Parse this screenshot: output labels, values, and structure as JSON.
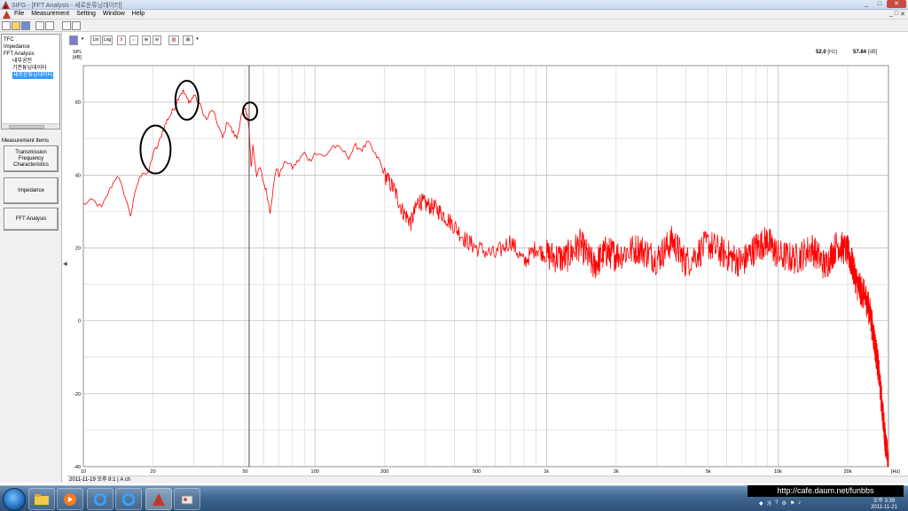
{
  "window": {
    "title": "SIFG - [FFT Analysis - 새로운튜닝데이터]",
    "controls": [
      "_",
      "□",
      "✕"
    ]
  },
  "menu": {
    "items": [
      "File",
      "Measurement",
      "Setting",
      "Window",
      "Help"
    ],
    "mdi_controls": [
      "_",
      "□",
      "✕"
    ]
  },
  "tree": {
    "items": [
      {
        "label": "TFC",
        "indent": 0
      },
      {
        "label": "Impedance",
        "indent": 0
      },
      {
        "label": "FFT Analysis",
        "indent": 0
      },
      {
        "label": "내부공진",
        "indent": 1
      },
      {
        "label": "기존튜닝데이터",
        "indent": 1
      },
      {
        "label": "새로운튜닝데이터",
        "indent": 1,
        "selected": true
      }
    ]
  },
  "measurement_items": {
    "header": "Measurement Items",
    "buttons": [
      "Transmission Frequency Characteristics",
      "Impedance",
      "FFT Analysis"
    ]
  },
  "chart_toolbar": {
    "lin_label": "Lin",
    "log_label": "Log"
  },
  "readout": {
    "freq_value": "52.0",
    "freq_unit": "[Hz]",
    "spl_value": "57.84",
    "spl_unit": "[dB]"
  },
  "status": {
    "text": "2011-11-19 오후 8:1 | A ch"
  },
  "taskbar": {
    "clock_time": "오후 3:39",
    "clock_date": "2011-11-21",
    "ime": "가"
  },
  "watermark": "http://cafe.daum.net/funbbs",
  "chart_data": {
    "type": "line",
    "ylabel": "SPL [dB]",
    "xunit": "[Hz]",
    "x_scale": "log",
    "xlim": [
      10,
      30000
    ],
    "ylim": [
      -40,
      70
    ],
    "yticks": [
      -40,
      -20,
      0,
      20,
      40,
      60
    ],
    "xtick_labels": [
      {
        "value": 10,
        "label": "10"
      },
      {
        "value": 20,
        "label": "20"
      },
      {
        "value": 50,
        "label": "50"
      },
      {
        "value": 100,
        "label": "100"
      },
      {
        "value": 200,
        "label": "200"
      },
      {
        "value": 500,
        "label": "500"
      },
      {
        "value": 1000,
        "label": "1k"
      },
      {
        "value": 2000,
        "label": "2k"
      },
      {
        "value": 5000,
        "label": "5k"
      },
      {
        "value": 10000,
        "label": "10k"
      },
      {
        "value": 20000,
        "label": "20k"
      }
    ],
    "grid": true,
    "cursor_x": 52,
    "line_color": "#ff0000",
    "series": [
      {
        "x": [
          10,
          11,
          12,
          13,
          14,
          15,
          16,
          17,
          18,
          19,
          20,
          21,
          22,
          23,
          24,
          25,
          26,
          27,
          28,
          29,
          30,
          32,
          34,
          36,
          38,
          40,
          42,
          44,
          46,
          48,
          50,
          51,
          52,
          53,
          54,
          55,
          56,
          58,
          60,
          62,
          64,
          66,
          68,
          70,
          75,
          80,
          85,
          90,
          95,
          100,
          110,
          120,
          130,
          140,
          150,
          160,
          170,
          180,
          190,
          200,
          220,
          240,
          260,
          280,
          300,
          330,
          360,
          400,
          450,
          500,
          600,
          700,
          800,
          900,
          1000,
          1200,
          1400,
          1600,
          1800,
          2000,
          2500,
          3000,
          3500,
          4000,
          5000,
          6000,
          7000,
          8000,
          9000,
          10000,
          12000,
          14000,
          16000,
          18000,
          20000,
          21000,
          22000,
          23000,
          24000,
          25000,
          26000,
          27000,
          28000,
          29000,
          30000
        ],
        "y": [
          32,
          33,
          31,
          36,
          40,
          35,
          29,
          37,
          41,
          40,
          46,
          48,
          52,
          55,
          57,
          59,
          62,
          63,
          61,
          60,
          62,
          59,
          55,
          58,
          54,
          50,
          55,
          52,
          50,
          56,
          58,
          57,
          52,
          42,
          48,
          44,
          40,
          42,
          38,
          35,
          30,
          36,
          42,
          40,
          44,
          42,
          44,
          46,
          44,
          46,
          45,
          48,
          47,
          45,
          48,
          47,
          49,
          46,
          44,
          40,
          36,
          30,
          27,
          33,
          32,
          31,
          29,
          26,
          22,
          20,
          18,
          22,
          16,
          20,
          18,
          17,
          21,
          15,
          19,
          18,
          20,
          17,
          22,
          16,
          21,
          18,
          16,
          20,
          22,
          18,
          17,
          20,
          15,
          21,
          19,
          15,
          10,
          8,
          6,
          2,
          -5,
          -12,
          -22,
          -32,
          -40
        ]
      }
    ]
  }
}
